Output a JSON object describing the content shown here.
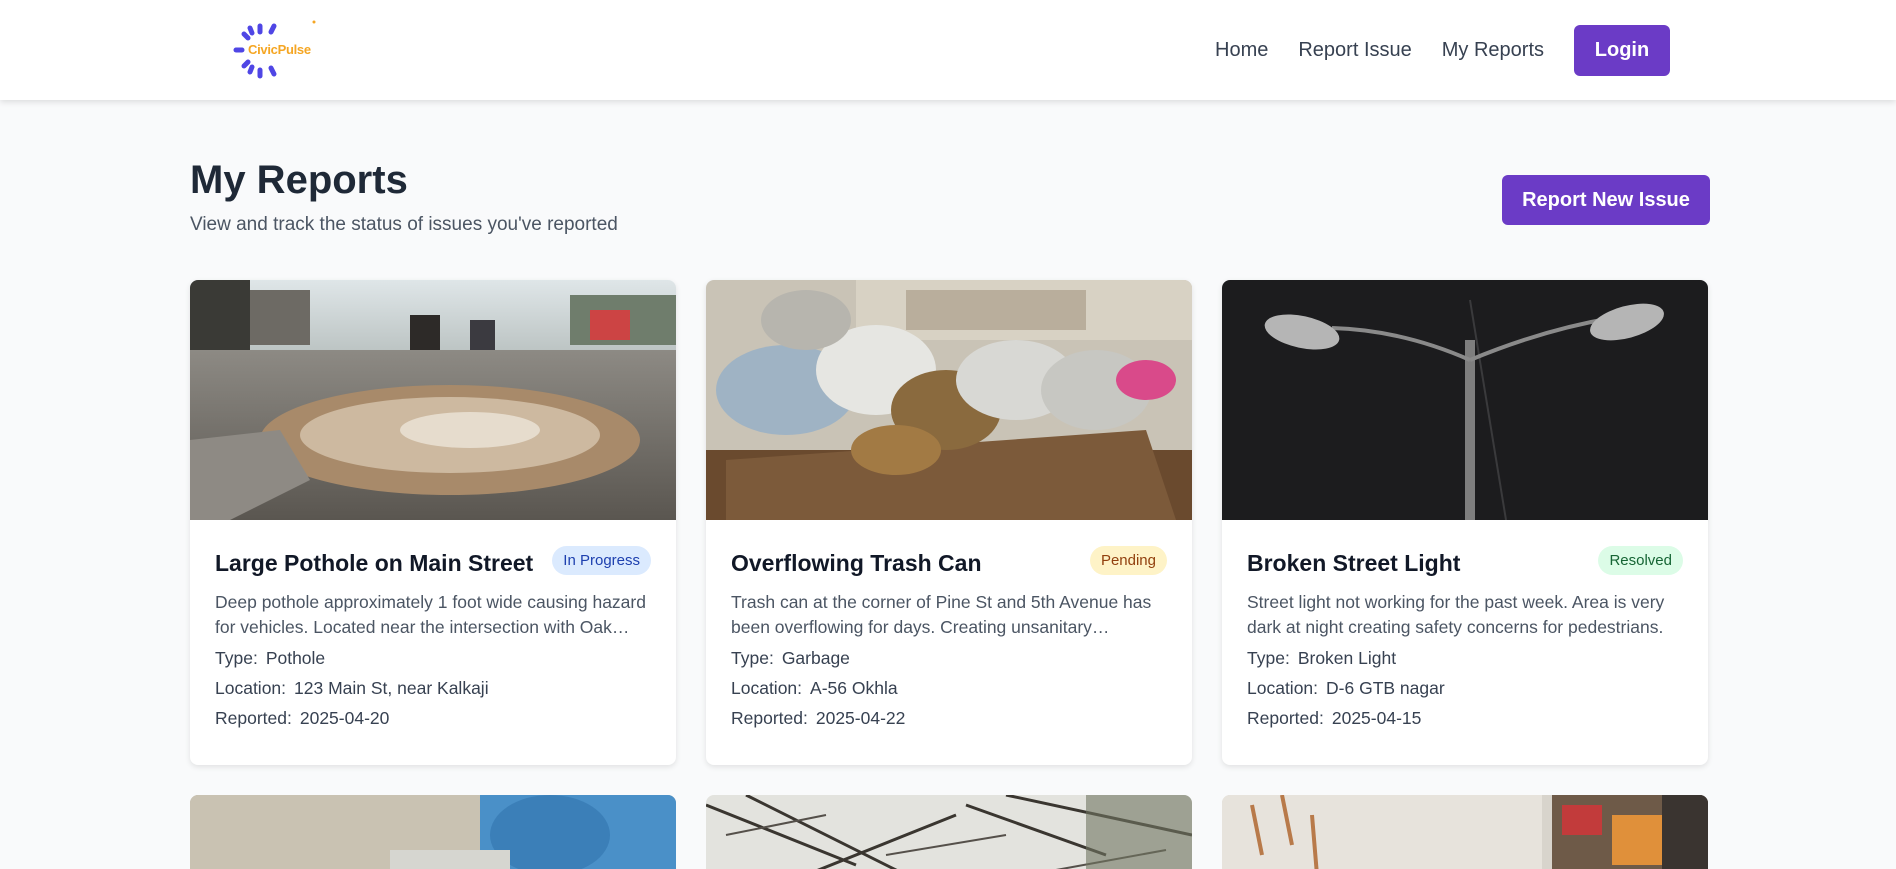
{
  "nav": {
    "logo_text": "CivicPulse",
    "links": [
      {
        "label": "Home"
      },
      {
        "label": "Report Issue"
      },
      {
        "label": "My Reports"
      }
    ],
    "login_label": "Login"
  },
  "header": {
    "title": "My Reports",
    "subtitle": "View and track the status of issues you've reported",
    "new_issue_label": "Report New Issue"
  },
  "meta_labels": {
    "type": "Type:",
    "location": "Location:",
    "reported": "Reported:"
  },
  "reports": [
    {
      "title": "Large Pothole on Main Street",
      "status": "In Progress",
      "description": "Deep pothole approximately 1 foot wide causing hazard for vehicles. Located near the intersection with Oak…",
      "type": "Pothole",
      "location": "123 Main St, near Kalkaji",
      "reported": "2025-04-20"
    },
    {
      "title": "Overflowing Trash Can",
      "status": "Pending",
      "description": "Trash can at the corner of Pine St and 5th Avenue has been overflowing for days. Creating unsanitary…",
      "type": "Garbage",
      "location": "A-56 Okhla",
      "reported": "2025-04-22"
    },
    {
      "title": "Broken Street Light",
      "status": "Resolved",
      "description": "Street light not working for the past week. Area is very dark at night creating safety concerns for pedestrians.",
      "type": "Broken Light",
      "location": "D-6 GTB nagar",
      "reported": "2025-04-15"
    }
  ],
  "colors": {
    "accent": "#6b3bc6",
    "in_progress_bg": "#dbeafe",
    "in_progress_text": "#1e40af",
    "pending_bg": "#fef3c7",
    "pending_text": "#92400e",
    "resolved_bg": "#dcfce7",
    "resolved_text": "#166534"
  }
}
